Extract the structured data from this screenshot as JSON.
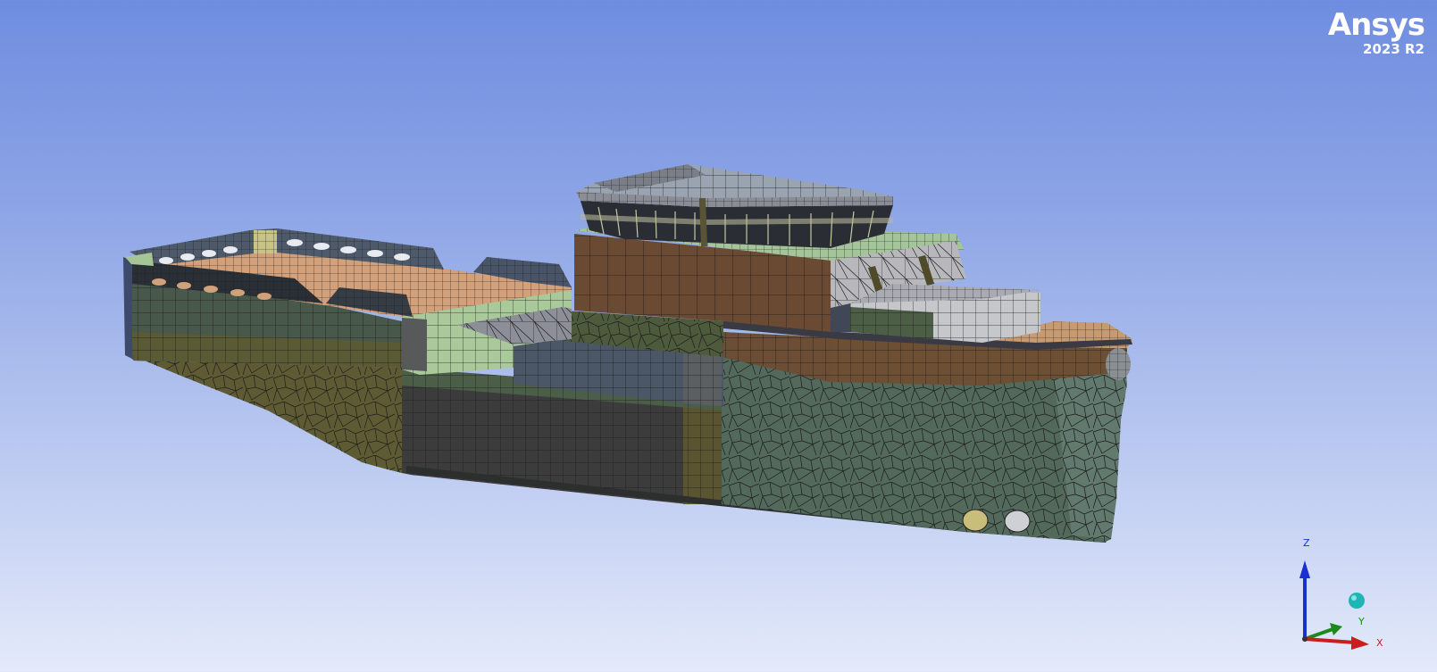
{
  "branding": {
    "product": "Ansys",
    "version": "2023 R2"
  },
  "triad": {
    "z_label": "Z",
    "y_label": "Y",
    "x_label": "X",
    "colors": {
      "z": "#1a2fcf",
      "y": "#1b8a1b",
      "x": "#c81e1e",
      "iso_sphere": "#1fb5b5"
    }
  },
  "viewport": {
    "background_top": "#6f8de0",
    "background_bottom": "#e4eafa",
    "model": "meshed-ship-hull"
  }
}
